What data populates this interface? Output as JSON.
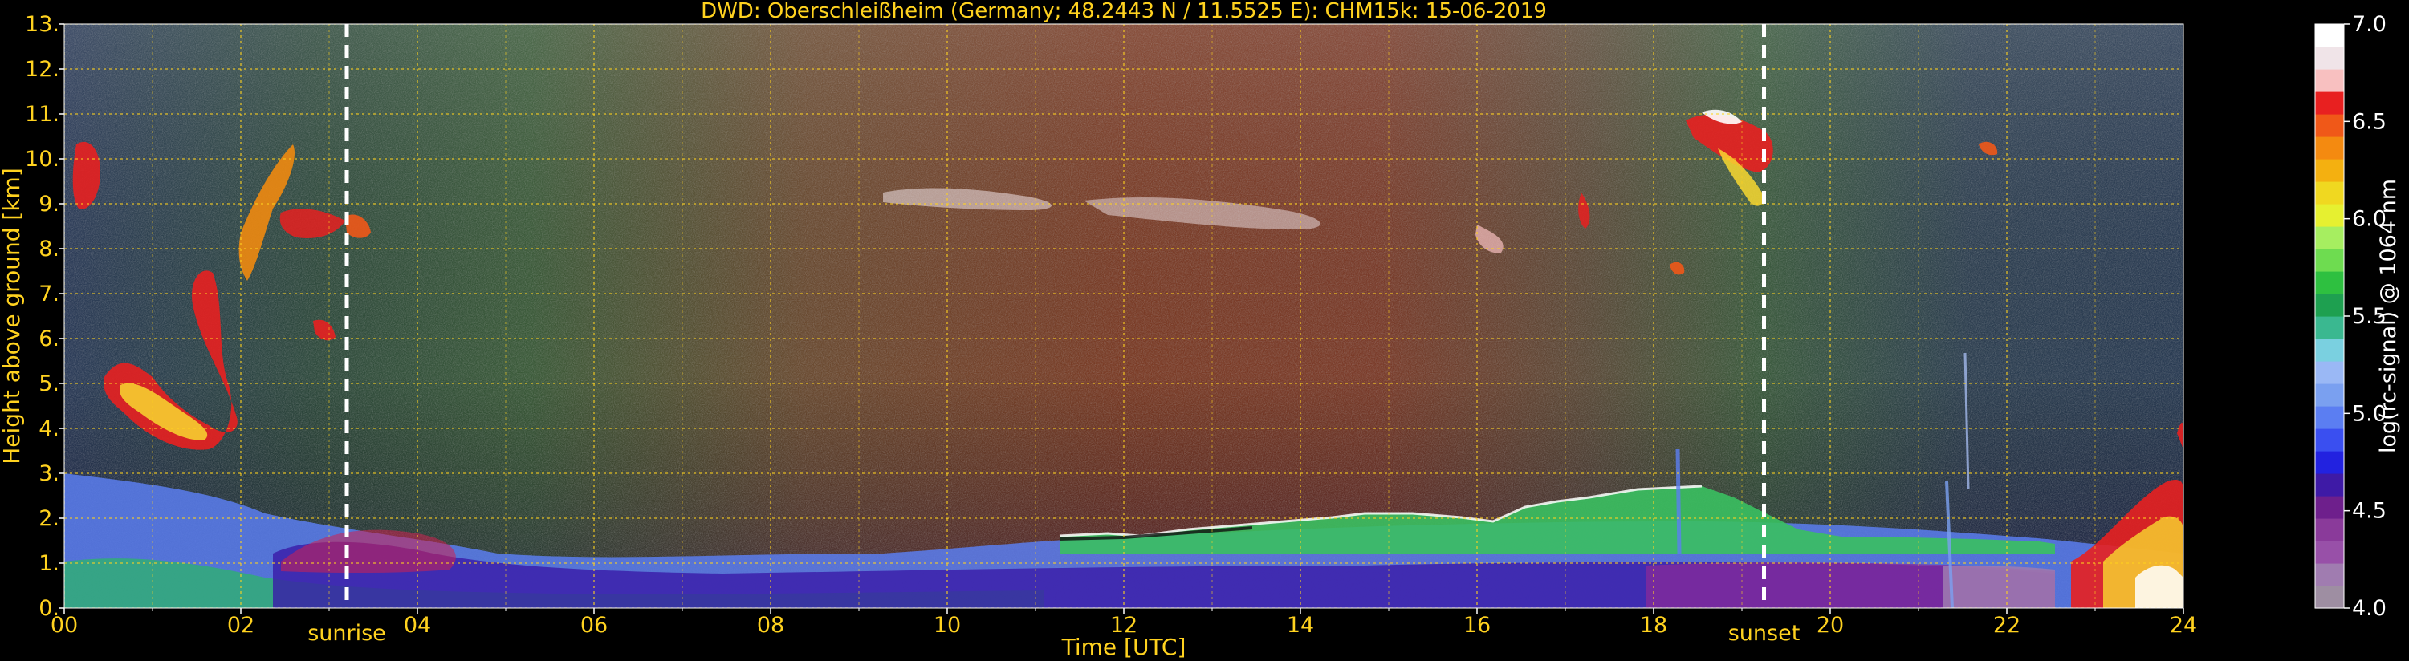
{
  "chart_data": {
    "type": "heatmap",
    "title": "DWD: Oberschleißheim (Germany; 48.2443 N / 11.5525 E):    CHM15k: 15-06-2019",
    "xlabel": "Time [UTC]",
    "ylabel": "Height above ground [km]",
    "x_ticks": [
      "00",
      "02",
      "04",
      "06",
      "08",
      "10",
      "12",
      "14",
      "16",
      "18",
      "20",
      "22",
      "24"
    ],
    "y_ticks": [
      "0.",
      "1.",
      "2.",
      "3.",
      "4.",
      "5.",
      "6.",
      "7.",
      "8.",
      "9.",
      "10.",
      "11.",
      "12.",
      "13."
    ],
    "xlim": [
      0,
      24
    ],
    "ylim": [
      0,
      13
    ],
    "grid": true,
    "colorbar": {
      "label": "log(rc-signal) @ 1064 nm",
      "range": [
        4.0,
        7.0
      ],
      "ticks": [
        "4.0",
        "4.5",
        "5.0",
        "5.5",
        "6.0",
        "6.5",
        "7.0"
      ],
      "colors": [
        "#9e8ea2",
        "#a07cb0",
        "#9850a8",
        "#8a3a9a",
        "#6e1f8c",
        "#3e1aa6",
        "#2222e0",
        "#3a4ff0",
        "#5b7ef2",
        "#7aa0f0",
        "#9ab8f5",
        "#7ad0e0",
        "#3ab890",
        "#1ea050",
        "#2ec040",
        "#6edc50",
        "#a6ee60",
        "#e6f030",
        "#f0d820",
        "#f4b010",
        "#f48a10",
        "#f05818",
        "#e82020",
        "#f8c0c0",
        "#f0e4e8",
        "#ffffff"
      ]
    },
    "annotations": [
      {
        "label": "sunrise",
        "x": 3.2
      },
      {
        "label": "sunset",
        "x": 19.25
      }
    ]
  }
}
